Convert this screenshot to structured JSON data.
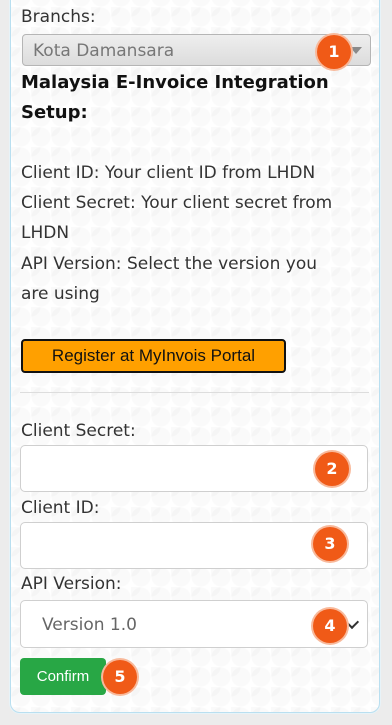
{
  "form": {
    "branch_label": "Branchs:",
    "branch_value": "Kota Damansara",
    "setup_title": "Malaysia E-Invoice Integration Setup:",
    "instructions": [
      "Client ID: Your client ID from LHDN",
      "Client Secret: Your client secret from",
      "LHDN",
      "API Version: Select the version you",
      "are using"
    ],
    "register_button": "Register at MyInvois Portal",
    "client_secret_label": "Client Secret:",
    "client_secret_value": "",
    "client_id_label": "Client ID:",
    "client_id_value": "",
    "api_version_label": "API Version:",
    "api_version_value": "Version 1.0",
    "confirm_button": "Confirm"
  },
  "badges": [
    "1",
    "2",
    "3",
    "4",
    "5"
  ],
  "colors": {
    "badge": "#f05a17",
    "register_button": "#ffa000",
    "confirm_button": "#28a745",
    "panel_border": "#b9dff0"
  }
}
